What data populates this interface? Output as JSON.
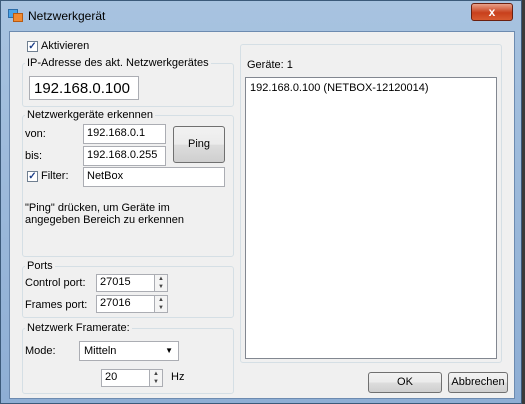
{
  "window": {
    "title": "Netzwerkgerät",
    "close_glyph": "x"
  },
  "activate": {
    "label": "Aktivieren",
    "checked": true
  },
  "ip_address": {
    "label": "IP-Adresse des akt. Netzwerkgerätes",
    "value": "192.168.0.100"
  },
  "detect": {
    "group_title": "Netzwerkgeräte erkennen",
    "from_label": "von:",
    "from_value": "192.168.0.1",
    "to_label": "bis:",
    "to_value": "192.168.0.255",
    "ping_label": "Ping",
    "filter_label": "Filter:",
    "filter_checked": true,
    "filter_value": "NetBox",
    "hint": "\"Ping\" drücken, um Geräte im angegeben Bereich zu erkennen"
  },
  "ports": {
    "group_title": "Ports",
    "control_label": "Control port:",
    "control_value": "27015",
    "frames_label": "Frames port:",
    "frames_value": "27016"
  },
  "framerate": {
    "group_title": "Netzwerk Framerate:",
    "mode_label": "Mode:",
    "mode_value": "Mitteln",
    "rate_value": "20",
    "unit": "Hz"
  },
  "devices": {
    "header": "Geräte: 1",
    "items": [
      "192.168.0.100 (NETBOX-12120014)"
    ]
  },
  "buttons": {
    "ok": "OK",
    "cancel": "Abbrechen"
  },
  "icons": {
    "app": "network-device-icon",
    "close": "close-icon",
    "dropdown": "chevron-down-icon"
  }
}
